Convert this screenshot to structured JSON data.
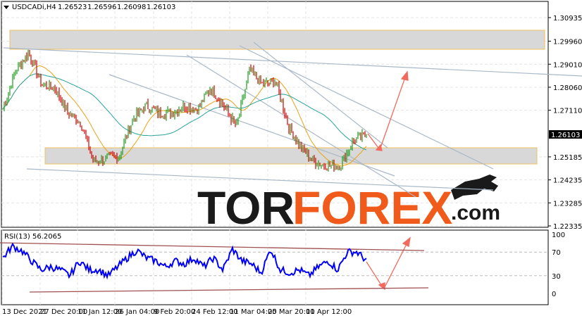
{
  "header": {
    "symbol": "USDCADi,H4",
    "open": "1.26523",
    "high": "1.26596",
    "low": "1.26098",
    "close": "1.26103"
  },
  "price_axis": {
    "ticks": [
      "1.30935",
      "1.29960",
      "1.29010",
      "1.28060",
      "1.27110",
      "1.25185",
      "1.24235",
      "1.23285",
      "1.22335"
    ],
    "current": "1.26103"
  },
  "rsi": {
    "label": "RSI(13) 56.2065",
    "ticks": [
      "100",
      "70",
      "30",
      "0"
    ]
  },
  "time_axis": {
    "labels": [
      "13 Dec 2021",
      "27 Dec 20:00",
      "11 Jan 12:00",
      "26 Jan 04:00",
      "9 Feb 20:00",
      "24 Feb 12:00",
      "11 Mar 04:00",
      "25 Mar 20:00",
      "11 Apr 12:00"
    ]
  },
  "logo": {
    "tor": "TOR",
    "forex": "FOREX",
    "com": ".com"
  },
  "colors": {
    "bull": "#1a9e1a",
    "bear": "#d40000",
    "ma_fast": "#e8a317",
    "ma_slow": "#2aa39a",
    "rsi": "#0000ff",
    "arrow": "#f26a5e",
    "logo_orange": "#f05a1a"
  },
  "chart_data": {
    "type": "candlestick",
    "price_range": [
      1.22335,
      1.30935
    ],
    "close_waypoints": [
      1.2716,
      1.2876,
      1.2948,
      1.2818,
      1.2803,
      1.2701,
      1.2658,
      1.2497,
      1.2511,
      1.2526,
      1.2672,
      1.273,
      1.2701,
      1.2701,
      1.273,
      1.2716,
      1.2803,
      1.273,
      1.2643,
      1.2876,
      1.2818,
      1.2832,
      1.2643,
      1.2556,
      1.2497,
      1.2483,
      1.2483,
      1.2585,
      1.261
    ],
    "rsi_waypoints": [
      60,
      80,
      72,
      55,
      40,
      45,
      40,
      30,
      55,
      40,
      40,
      30,
      45,
      60,
      73,
      60,
      55,
      45,
      55,
      50,
      60,
      45,
      60,
      40,
      75,
      55,
      50,
      35,
      75,
      40,
      35,
      40,
      30,
      45,
      55,
      40,
      70,
      70,
      56
    ],
    "rsi_levels": [
      70,
      30
    ]
  }
}
